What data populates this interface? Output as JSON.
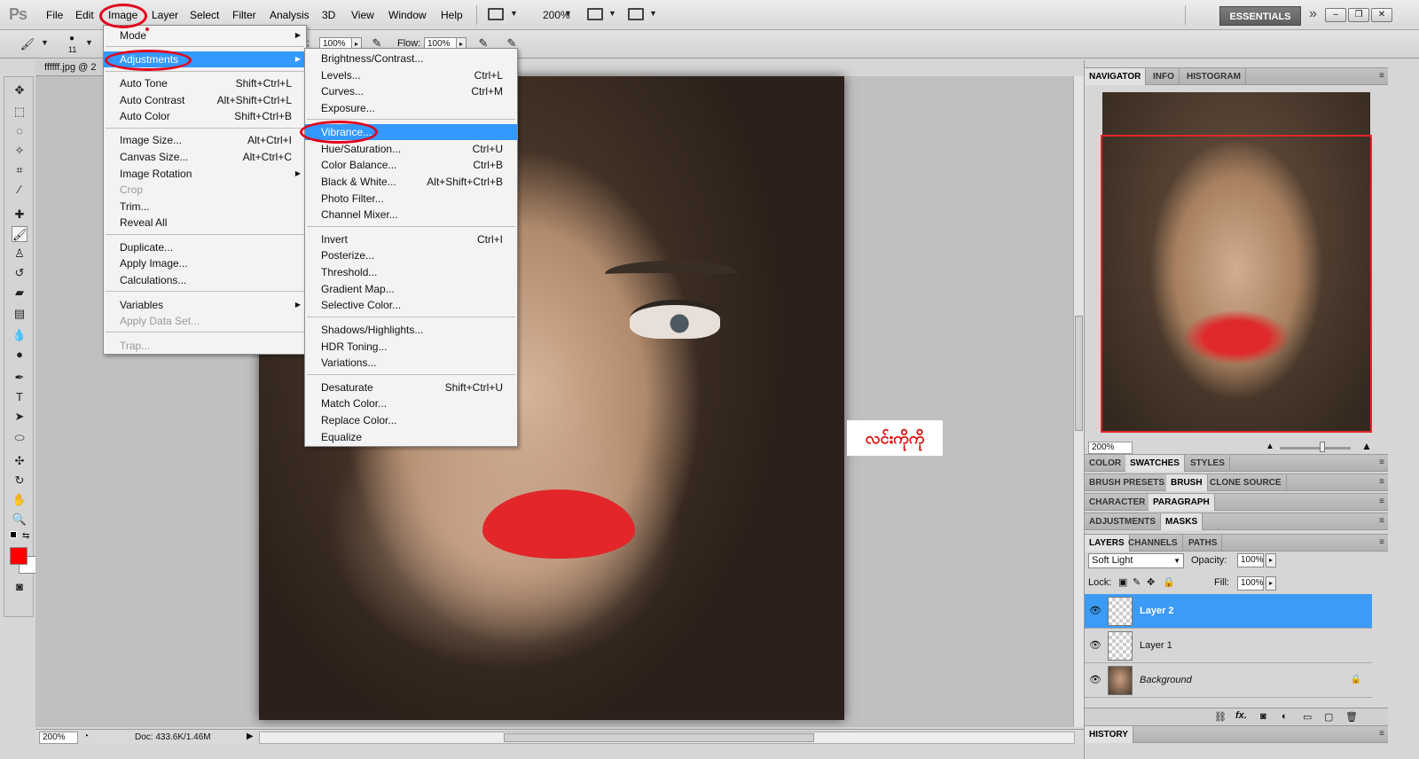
{
  "app": {
    "logo": "Ps"
  },
  "menubar": {
    "items": [
      "File",
      "Edit",
      "Image",
      "Layer",
      "Select",
      "Filter",
      "Analysis",
      "3D",
      "View",
      "Window",
      "Help"
    ],
    "zoom": "200%",
    "workspace": "ESSENTIALS",
    "more": "»"
  },
  "options": {
    "brush_size": "11",
    "opacity_label": "Opacity:",
    "opacity_value": "100%",
    "flow_label": "Flow:",
    "flow_value": "100%"
  },
  "document": {
    "tab_label": "ffffff.jpg @ 2"
  },
  "annotation": {
    "text": "လင်းကိုကို"
  },
  "image_menu": {
    "mode": "Mode",
    "adjustments": "Adjustments",
    "auto_tone": "Auto Tone",
    "auto_tone_sc": "Shift+Ctrl+L",
    "auto_contrast": "Auto Contrast",
    "auto_contrast_sc": "Alt+Shift+Ctrl+L",
    "auto_color": "Auto Color",
    "auto_color_sc": "Shift+Ctrl+B",
    "image_size": "Image Size...",
    "image_size_sc": "Alt+Ctrl+I",
    "canvas_size": "Canvas Size...",
    "canvas_size_sc": "Alt+Ctrl+C",
    "image_rotation": "Image Rotation",
    "crop": "Crop",
    "trim": "Trim...",
    "reveal_all": "Reveal All",
    "duplicate": "Duplicate...",
    "apply_image": "Apply Image...",
    "calculations": "Calculations...",
    "variables": "Variables",
    "apply_data_set": "Apply Data Set...",
    "trap": "Trap..."
  },
  "adjustments_menu": {
    "brightness": "Brightness/Contrast...",
    "levels": "Levels...",
    "levels_sc": "Ctrl+L",
    "curves": "Curves...",
    "curves_sc": "Ctrl+M",
    "exposure": "Exposure...",
    "vibrance": "Vibrance...",
    "hue_sat": "Hue/Saturation...",
    "hue_sat_sc": "Ctrl+U",
    "color_balance": "Color Balance...",
    "color_balance_sc": "Ctrl+B",
    "black_white": "Black & White...",
    "black_white_sc": "Alt+Shift+Ctrl+B",
    "photo_filter": "Photo Filter...",
    "channel_mixer": "Channel Mixer...",
    "invert": "Invert",
    "invert_sc": "Ctrl+I",
    "posterize": "Posterize...",
    "threshold": "Threshold...",
    "gradient_map": "Gradient Map...",
    "selective_color": "Selective Color...",
    "shadows_highlights": "Shadows/Highlights...",
    "hdr_toning": "HDR Toning...",
    "variations": "Variations...",
    "desaturate": "Desaturate",
    "desaturate_sc": "Shift+Ctrl+U",
    "match_color": "Match Color...",
    "replace_color": "Replace Color...",
    "equalize": "Equalize"
  },
  "panels": {
    "nav_tabs": [
      "NAVIGATOR",
      "INFO",
      "HISTOGRAM"
    ],
    "nav_zoom": "200%",
    "color_tabs": [
      "COLOR",
      "SWATCHES",
      "STYLES"
    ],
    "brush_tabs": [
      "BRUSH PRESETS",
      "BRUSH",
      "CLONE SOURCE"
    ],
    "char_tabs": [
      "CHARACTER",
      "PARAGRAPH"
    ],
    "adj_tabs": [
      "ADJUSTMENTS",
      "MASKS"
    ],
    "layer_tabs": [
      "LAYERS",
      "CHANNELS",
      "PATHS"
    ],
    "blend_mode": "Soft Light",
    "opacity_label": "Opacity:",
    "opacity_value": "100%",
    "lock_label": "Lock:",
    "fill_label": "Fill:",
    "fill_value": "100%",
    "layers": [
      {
        "name": "Layer 2"
      },
      {
        "name": "Layer 1"
      },
      {
        "name": "Background"
      }
    ],
    "history_tab": "HISTORY"
  },
  "status": {
    "zoom": "200%",
    "doc": "Doc: 433.6K/1.46M"
  },
  "colors": {
    "foreground": "#ff0000",
    "background": "#ffffff",
    "highlight": "#3399ff",
    "annotation": "#e3001b"
  }
}
